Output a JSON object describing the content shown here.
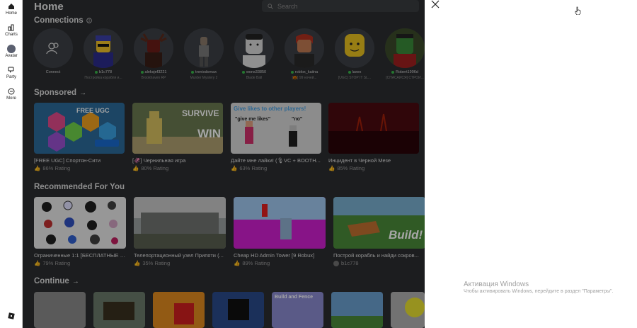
{
  "nav": {
    "items": [
      {
        "label": "Home",
        "icon": "home-icon"
      },
      {
        "label": "Charts",
        "icon": "charts-icon"
      },
      {
        "label": "Avatar",
        "icon": "avatar-icon"
      },
      {
        "label": "Party",
        "icon": "party-icon"
      },
      {
        "label": "More",
        "icon": "more-icon"
      }
    ]
  },
  "header": {
    "title": "Home",
    "search_placeholder": "Search"
  },
  "connections": {
    "title": "Connections",
    "friends": [
      {
        "name": "Connect",
        "status": "",
        "online": false
      },
      {
        "name": "b1c778",
        "status": "Постройка корабля и...",
        "online": true
      },
      {
        "name": "aleksjef3221",
        "status": "Brookhaven RP",
        "online": true
      },
      {
        "name": "trenixdomax",
        "status": "Murder Mystery 2",
        "online": true
      },
      {
        "name": "wons33850",
        "status": "Blade Ball",
        "online": true
      },
      {
        "name": "roblox_kaiina",
        "status": "[🎃] 99 ночей...",
        "online": true
      },
      {
        "name": "laxex",
        "status": "[UGC] STOP IT SL...",
        "online": true
      },
      {
        "name": "Robert1996d",
        "status": "[СПАСАЙСЯ] СТРОИ...",
        "online": true
      }
    ]
  },
  "sponsored": {
    "title": "Sponsored",
    "items": [
      {
        "title": "[FREE UGC] Спортян-Сити",
        "rating": "86% Rating"
      },
      {
        "title": "[🦑] Чернильная игра",
        "rating": "80% Rating"
      },
      {
        "title": "Дайте мне лайки! (🎙VC + BOOTH...",
        "rating": "63% Rating"
      },
      {
        "title": "Инцидент в Черной Мезе",
        "rating": "85% Rating"
      }
    ],
    "thumb_texts": {
      "free_ugc": "FREE UGC",
      "survive": "SURVIVE",
      "win": "WIN",
      "likes_banner": "Give likes to other players!",
      "give_me_likes": "\"give me likes\"",
      "no": "\"no\""
    }
  },
  "recommended": {
    "title": "Recommended For You",
    "items": [
      {
        "title": "Ограниченные 1:1 [БЕСПЛАТНЫЕ U...",
        "rating": "79% Rating"
      },
      {
        "title": "Телепортационный узел Припяти (...",
        "rating": "35% Rating"
      },
      {
        "title": "Cheap HD Admin Tower [9 Robux]",
        "rating": "89% Rating"
      },
      {
        "title": "Построй корабль и найди сокров...",
        "rating": "b1c778"
      }
    ],
    "thumb_texts": {
      "build": "Build!"
    }
  },
  "continue": {
    "title": "Continue",
    "thumb_texts": {
      "build_and_fence": "Build and Fence"
    }
  },
  "panel": {
    "activation_title": "Активация Windows",
    "activation_text": "Чтобы активировать Windows, перейдите в раздел \"Параметры\"."
  }
}
